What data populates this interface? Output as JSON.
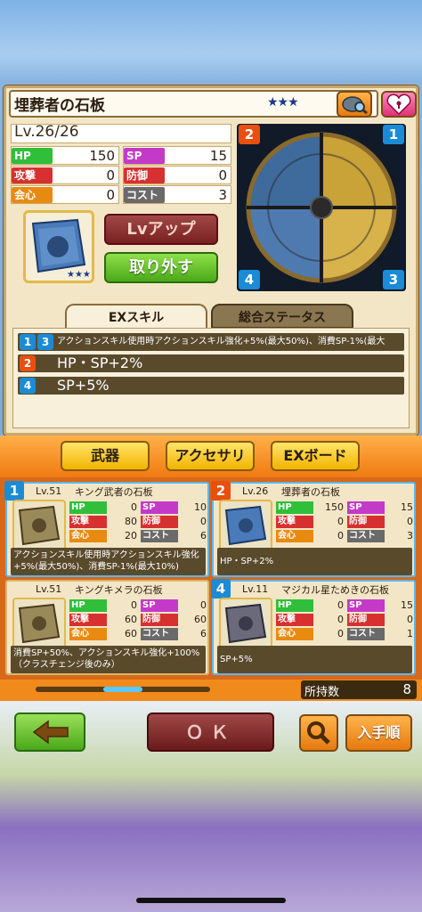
{
  "item": {
    "name": "埋葬者の石板",
    "stars": "★★★",
    "level": "Lv.26/26",
    "stats": [
      {
        "label": "HP",
        "value": "150",
        "color": "#2fbf3a"
      },
      {
        "label": "SP",
        "value": "15",
        "color": "#c43ac8"
      },
      {
        "label": "攻撃",
        "value": "0",
        "color": "#d73030"
      },
      {
        "label": "防御",
        "value": "0",
        "color": "#d73030"
      },
      {
        "label": "会心",
        "value": "0",
        "color": "#e98a10"
      },
      {
        "label": "コスト",
        "value": "3",
        "color": "#6a6a6a"
      }
    ],
    "lvup_label": "Lvアップ",
    "remove_label": "取り外す",
    "thumb_stars": "★★★"
  },
  "board": {
    "corners": [
      "2",
      "1",
      "4",
      "3"
    ]
  },
  "tabs": {
    "ex": "EXスキル",
    "status": "総合ステータス"
  },
  "skills": [
    {
      "badges": [
        "1",
        "3"
      ],
      "text": "アクションスキル使用時アクションスキル強化+5%(最大50%)、消費SP-1%(最大10%)"
    },
    {
      "badges": [
        "2"
      ],
      "text": "HP・SP+2%"
    },
    {
      "badges": [
        "4"
      ],
      "text": "SP+5%"
    }
  ],
  "categories": [
    "武器",
    "アクセサリ",
    "EXボード"
  ],
  "cards": [
    {
      "slot": "1",
      "level": "Lv.51",
      "name": "キング武者の石板",
      "stars": "★★★★",
      "stats": [
        [
          "HP",
          "0"
        ],
        [
          "SP",
          "10"
        ],
        [
          "攻撃",
          "80"
        ],
        [
          "防御",
          "0"
        ],
        [
          "会心",
          "20"
        ],
        [
          "コスト",
          "6"
        ]
      ],
      "desc": "アクションスキル使用時アクションスキル強化+5%(最大50%)、消費SP-1%(最大10%)"
    },
    {
      "slot": "2",
      "level": "Lv.26",
      "name": "埋葬者の石板",
      "stars": "★★★",
      "stats": [
        [
          "HP",
          "150"
        ],
        [
          "SP",
          "15"
        ],
        [
          "攻撃",
          "0"
        ],
        [
          "防御",
          "0"
        ],
        [
          "会心",
          "0"
        ],
        [
          "コスト",
          "3"
        ]
      ],
      "desc": "HP・SP+2%"
    },
    {
      "slot": "",
      "level": "Lv.51",
      "name": "キングキメラの石板",
      "stars": "★★★★",
      "stats": [
        [
          "HP",
          "0"
        ],
        [
          "SP",
          "0"
        ],
        [
          "攻撃",
          "60"
        ],
        [
          "防御",
          "60"
        ],
        [
          "会心",
          "60"
        ],
        [
          "コスト",
          "6"
        ]
      ],
      "desc": "消費SP+50%、アクションスキル強化+100%（クラスチェンジ後のみ）"
    },
    {
      "slot": "4",
      "level": "Lv.11",
      "name": "マジカル星ためきの石板",
      "stars": "★",
      "stats": [
        [
          "HP",
          "0"
        ],
        [
          "SP",
          "15"
        ],
        [
          "攻撃",
          "0"
        ],
        [
          "防御",
          "0"
        ],
        [
          "会心",
          "0"
        ],
        [
          "コスト",
          "1"
        ]
      ],
      "desc": "SP+5%"
    }
  ],
  "owned": {
    "label": "所持数",
    "value": "8"
  },
  "bottom": {
    "ok_label": "ＯＫ",
    "sort_label": "入手順"
  }
}
